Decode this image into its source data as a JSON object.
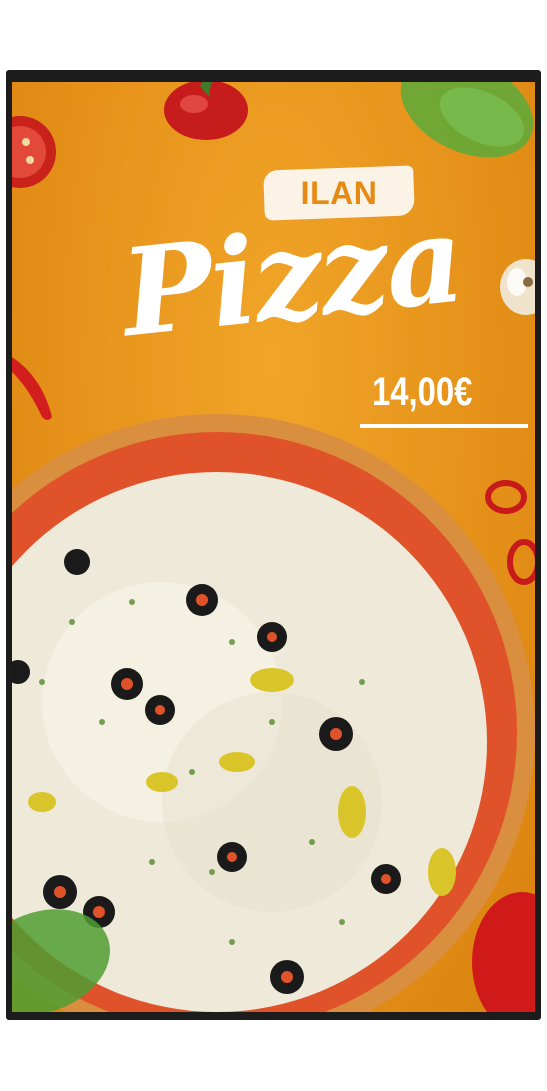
{
  "poster": {
    "brand": "ILAN",
    "product": "Pizza",
    "price": "14,00€"
  },
  "colors": {
    "background": "#e6921a",
    "title": "#ffffff",
    "brand_badge": "#fbf3e6",
    "brand_text": "#e58a12",
    "frame": "#1c1c1c"
  },
  "icons": [
    "bell-pepper-icon",
    "tomato-slice-icon",
    "basil-leaf-icon",
    "garlic-icon",
    "chili-pepper-icon",
    "pizza-icon"
  ]
}
